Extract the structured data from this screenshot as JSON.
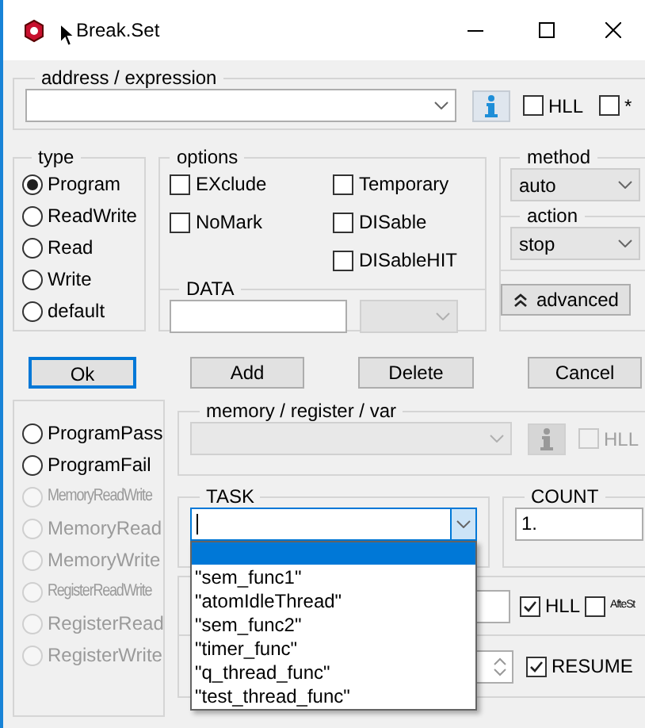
{
  "window": {
    "title": "Break.Set"
  },
  "address": {
    "legend": "address / expression",
    "hll": {
      "label": "HLL",
      "checked": false
    },
    "star": {
      "label": "*",
      "checked": false
    }
  },
  "type": {
    "legend": "type",
    "options": [
      {
        "label": "Program",
        "selected": true
      },
      {
        "label": "ReadWrite",
        "selected": false
      },
      {
        "label": "Read",
        "selected": false
      },
      {
        "label": "Write",
        "selected": false
      },
      {
        "label": "default",
        "selected": false
      }
    ]
  },
  "options": {
    "legend": "options",
    "checkboxes": [
      {
        "label": "EXclude",
        "checked": false
      },
      {
        "label": "Temporary",
        "checked": false
      },
      {
        "label": "NoMark",
        "checked": false
      },
      {
        "label": "DISable",
        "checked": false
      },
      {
        "label": "DISableHIT",
        "checked": false
      }
    ]
  },
  "data": {
    "legend": "DATA"
  },
  "method": {
    "legend": "method",
    "value": "auto"
  },
  "action": {
    "legend": "action",
    "value": "stop"
  },
  "advanced_button": {
    "label": "advanced"
  },
  "buttons": [
    {
      "label": "Ok",
      "default": true
    },
    {
      "label": "Add",
      "default": false
    },
    {
      "label": "Delete",
      "default": false
    },
    {
      "label": "Cancel",
      "default": false
    }
  ],
  "program_types": [
    {
      "label": "ProgramPass",
      "selected": false,
      "disabled": false,
      "condensed": false
    },
    {
      "label": "ProgramFail",
      "selected": false,
      "disabled": false,
      "condensed": false
    },
    {
      "label": "MemoryReadWrite",
      "selected": false,
      "disabled": true,
      "condensed": true
    },
    {
      "label": "MemoryRead",
      "selected": false,
      "disabled": true,
      "condensed": false
    },
    {
      "label": "MemoryWrite",
      "selected": false,
      "disabled": true,
      "condensed": false
    },
    {
      "label": "RegisterReadWrite",
      "selected": false,
      "disabled": true,
      "condensed": true
    },
    {
      "label": "RegisterRead",
      "selected": false,
      "disabled": true,
      "condensed": false
    },
    {
      "label": "RegisterWrite",
      "selected": false,
      "disabled": true,
      "condensed": false
    }
  ],
  "memory": {
    "legend": "memory / register / var",
    "disabled": true,
    "hll": {
      "label": "HLL",
      "checked": false
    }
  },
  "task": {
    "legend": "TASK",
    "open": true,
    "blank_row_highlighted": true,
    "items": [
      {
        "label": "\"sem_func1\"",
        "selected": false
      },
      {
        "label": "\"atomIdleThread\"",
        "selected": false
      },
      {
        "label": "\"sem_func2\"",
        "selected": false
      },
      {
        "label": "\"timer_func\"",
        "selected": false
      },
      {
        "label": "\"q_thread_func\"",
        "selected": false
      },
      {
        "label": "\"test_thread_func\"",
        "selected": false
      }
    ]
  },
  "count": {
    "legend": "COUNT",
    "value": "1."
  },
  "lower": {
    "hll": {
      "label": "HLL",
      "checked": true
    },
    "after_step": {
      "label": "AfteSt",
      "checked": false
    },
    "resume": {
      "label": "RESUME",
      "checked": true
    }
  }
}
